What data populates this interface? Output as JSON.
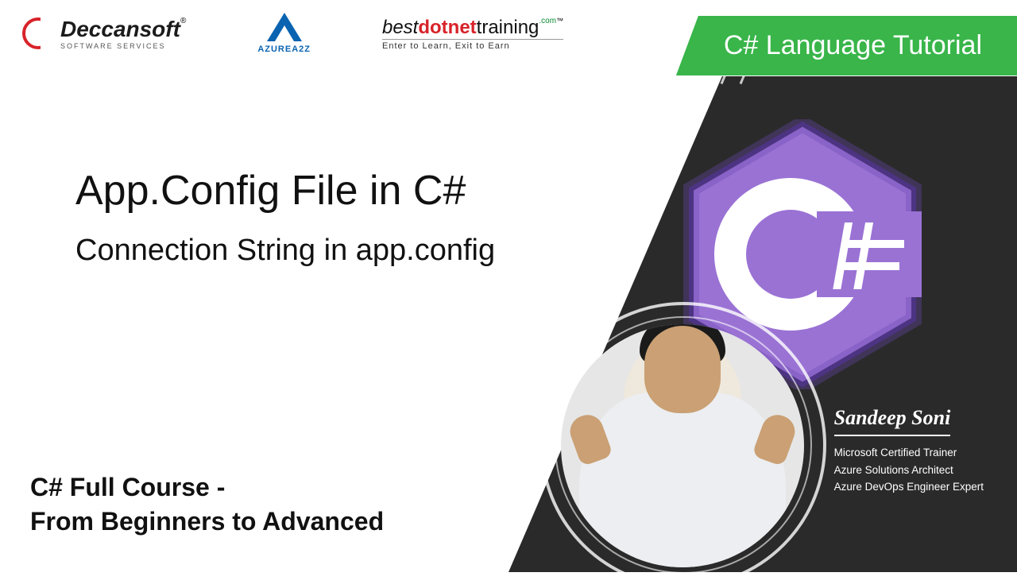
{
  "logos": {
    "deccansoft": {
      "name": "Deccansoft",
      "tag": "SOFTWARE  SERVICES",
      "reg": "®"
    },
    "azurea2z": {
      "label": "AZUREA2Z"
    },
    "bdt": {
      "best": "best",
      "dotnet": "dotnet",
      "training": "training",
      "com": ".com",
      "tm": "™",
      "tagline": "Enter to Learn, Exit to Earn"
    }
  },
  "banner": "C# Language Tutorial",
  "main": {
    "title": "App.Config File in C#",
    "subtitle": "Connection String in app.config"
  },
  "course": {
    "line1": "C# Full Course -",
    "line2": "From Beginners to Advanced"
  },
  "badge": {
    "letter": "C",
    "hash": "#"
  },
  "presenter": {
    "name": "Sandeep Soni",
    "creds": [
      "Microsoft Certified Trainer",
      "Azure Solutions Architect",
      "Azure DevOps Engineer Expert"
    ]
  }
}
